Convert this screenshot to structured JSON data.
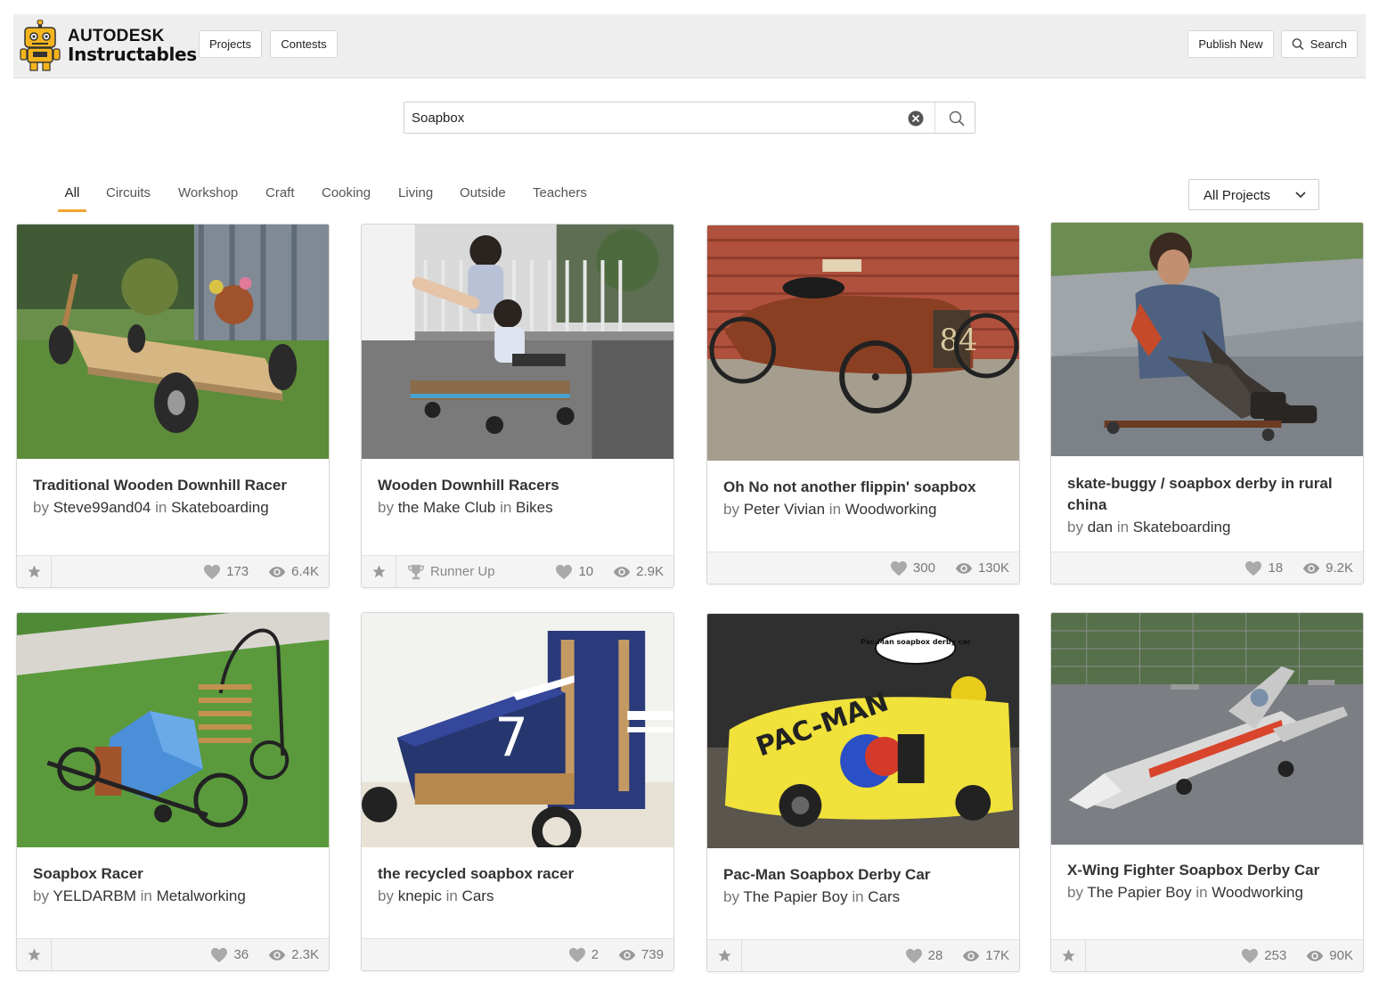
{
  "header": {
    "brand_line1": "AUTODESK",
    "brand_line2": "Instructables",
    "nav": [
      "Projects",
      "Contests"
    ],
    "publish_label": "Publish New",
    "search_label": "Search"
  },
  "search": {
    "value": "Soapbox"
  },
  "tabs": [
    {
      "label": "All",
      "active": true
    },
    {
      "label": "Circuits"
    },
    {
      "label": "Workshop"
    },
    {
      "label": "Craft"
    },
    {
      "label": "Cooking"
    },
    {
      "label": "Living"
    },
    {
      "label": "Outside"
    },
    {
      "label": "Teachers"
    }
  ],
  "filter": {
    "selected": "All Projects"
  },
  "cards": [
    {
      "title": "Traditional Wooden Downhill Racer",
      "by": "by",
      "author": "Steve99and04",
      "in": "in",
      "category": "Skateboarding",
      "likes": "173",
      "views": "6.4K"
    },
    {
      "title": "Wooden Downhill Racers",
      "by": "by",
      "author": "the Make Club",
      "in": "in",
      "category": "Bikes",
      "award": "Runner Up",
      "likes": "10",
      "views": "2.9K"
    },
    {
      "title": "Oh No not another flippin' soapbox",
      "by": "by",
      "author": "Peter Vivian",
      "in": "in",
      "category": "Woodworking",
      "likes": "300",
      "views": "130K"
    },
    {
      "title": "skate-buggy / soapbox derby in rural china",
      "by": "by",
      "author": "dan",
      "in": "in",
      "category": "Skateboarding",
      "likes": "18",
      "views": "9.2K"
    },
    {
      "title": "Soapbox Racer",
      "by": "by",
      "author": "YELDARBM",
      "in": "in",
      "category": "Metalworking",
      "likes": "36",
      "views": "2.3K"
    },
    {
      "title": "the recycled soapbox racer",
      "by": "by",
      "author": "knepic",
      "in": "in",
      "category": "Cars",
      "likes": "2",
      "views": "739"
    },
    {
      "title": "Pac-Man Soapbox Derby Car",
      "by": "by",
      "author": "The Papier Boy",
      "in": "in",
      "category": "Cars",
      "likes": "28",
      "views": "17K"
    },
    {
      "title": "X-Wing Fighter Soapbox Derby Car",
      "by": "by",
      "author": "The Papier Boy",
      "in": "in",
      "category": "Woodworking",
      "likes": "253",
      "views": "90K"
    }
  ],
  "thumb_text": {
    "pacman_bubble": "Pac-Man soapbox derby car",
    "car_number": "84",
    "race_number": "7",
    "pacman_sign": "PAC-MAN"
  },
  "icons": {
    "favorite": "star-icon",
    "likes": "heart-icon",
    "views": "eye-icon",
    "award": "trophy-icon",
    "search": "search-icon",
    "clear": "clear-icon",
    "dropdown": "chevron-down-icon",
    "logo": "robot-logo-icon"
  },
  "colors": {
    "accent": "#f2a42e",
    "header_bg": "#eeeeee",
    "footer_bg": "#f4f4f4"
  }
}
